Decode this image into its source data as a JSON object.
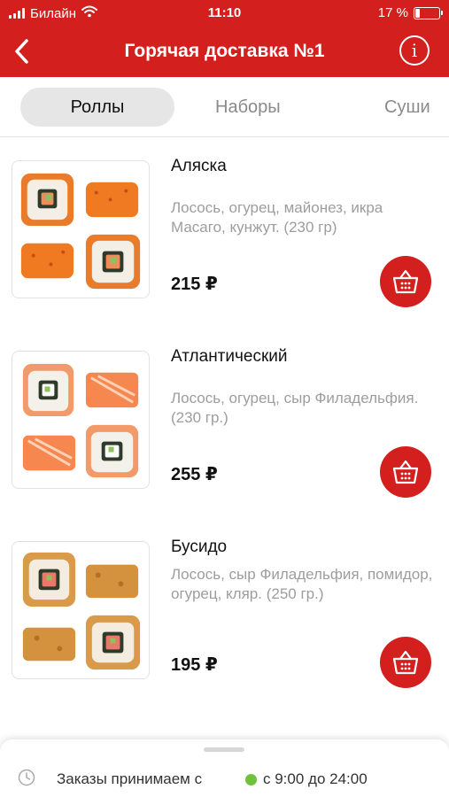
{
  "status_bar": {
    "carrier": "Билайн",
    "time": "11:10",
    "battery": "17 %",
    "battery_level": 0.17
  },
  "header": {
    "title": "Горячая доставка №1",
    "back_icon": "chevron-left-icon",
    "info_label": "i"
  },
  "tabs": [
    {
      "label": "Роллы",
      "active": true
    },
    {
      "label": "Наборы",
      "active": false
    },
    {
      "label": "Суши",
      "active": false
    }
  ],
  "products": [
    {
      "name": "Аляска",
      "description": "Лосось, огурец, майонез, икра Масаго, кунжут. (230 гр)",
      "price": "215 ₽"
    },
    {
      "name": "Атлантический",
      "description": "Лосось, огурец, сыр Филадельфия. (230 гр.)",
      "price": "255 ₽"
    },
    {
      "name": "Бусидо",
      "description": "Лосось, сыр Филадельфия, помидор, огурец, кляр. (250 гр.)",
      "price": "195 ₽"
    }
  ],
  "footer": {
    "hours_label": "Заказы принимаем с",
    "hours_value": "с 9:00 до 24:00"
  },
  "colors": {
    "accent": "#d41f1f",
    "open_indicator": "#6fc23b"
  }
}
